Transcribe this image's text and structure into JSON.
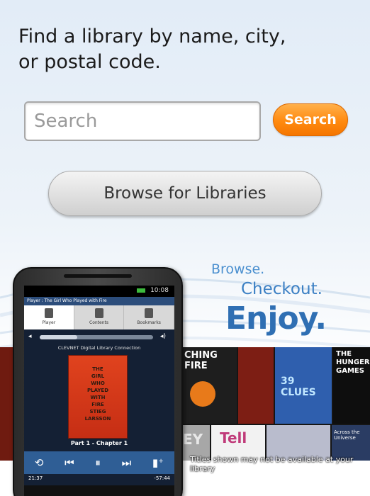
{
  "header": {
    "instructions_line1": "Find a library by name, city,",
    "instructions_line2": "or postal code."
  },
  "search": {
    "placeholder": "Search",
    "value": "",
    "button_label": "Search"
  },
  "browse": {
    "button_label": "Browse for Libraries"
  },
  "promo": {
    "tagline_1": "Browse.",
    "tagline_2": "Checkout.",
    "tagline_3": "Enjoy.",
    "disclaimer": "Titles shown may not be available at your library",
    "covers": [
      {
        "text": "CHING FIRE",
        "color": "#1e1e1e"
      },
      {
        "text": "",
        "color": "#7d1e14"
      },
      {
        "text": "39 CLUES",
        "color": "#2f5fae"
      },
      {
        "text": "THE HUNGER GAMES",
        "color": "#0e0e0e"
      },
      {
        "text": "EY",
        "color": "#a7a7a7"
      },
      {
        "text": "Tell",
        "color": "#f2f2f2"
      },
      {
        "text": "",
        "color": "#b9bccd"
      },
      {
        "text": "Across the Universe",
        "color": "#2a3c63"
      }
    ],
    "phone": {
      "status_time": "10:08",
      "title_bar": "Player : The Girl Who Played with Fire",
      "tabs": [
        "Player",
        "Contents",
        "Bookmarks"
      ],
      "progress": 0.33,
      "library_name": "CLEVNET Digital Library Connection",
      "book_title_lines": [
        "THE",
        "GIRL",
        "WHO",
        "PLAYED",
        "WITH",
        "FIRE",
        "STIEG",
        "LARSSON"
      ],
      "chapter": "Part 1 - Chapter 1",
      "elapsed": "21:37",
      "remaining": "-57:44",
      "control_icons": [
        "replay-icon",
        "previous-icon",
        "pause-icon",
        "next-icon",
        "bookmark-add-icon"
      ]
    }
  },
  "colors": {
    "accent_orange": "#ff8a10",
    "brand_blue": "#2f6fb3"
  }
}
